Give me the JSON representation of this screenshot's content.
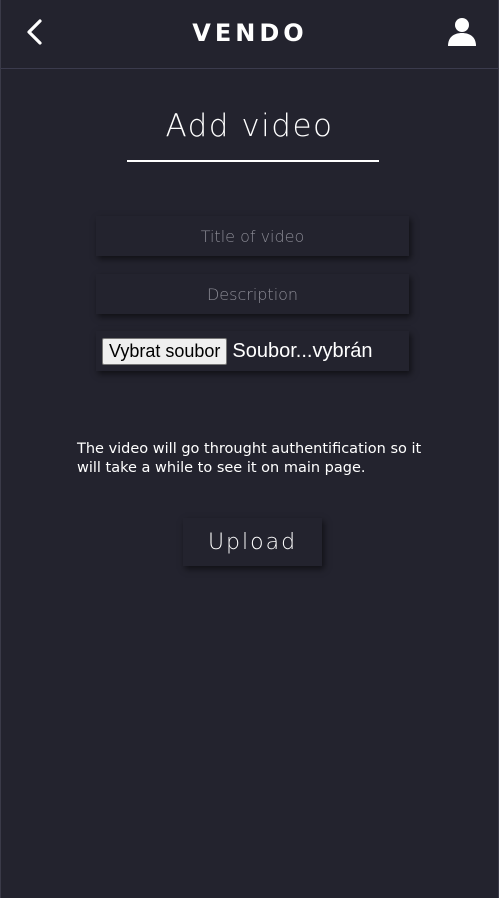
{
  "header": {
    "logo_text": "VENDO",
    "back_icon": "chevron-left-icon",
    "profile_icon": "user-icon"
  },
  "main": {
    "title": "Add video",
    "title_input": {
      "placeholder": "Title of video",
      "value": ""
    },
    "description_input": {
      "placeholder": "Description",
      "value": ""
    },
    "file_input": {
      "button_label": "Vybrat soubor",
      "status_text": "Soubor...vybrán"
    },
    "note": "The video will go throught authentification so it will take a while to see it on main page.",
    "upload_label": "Upload"
  },
  "colors": {
    "background": "#23232e",
    "text": "#ffffff",
    "placeholder": "#8b8b95",
    "header_border": "#3b3b4d"
  }
}
